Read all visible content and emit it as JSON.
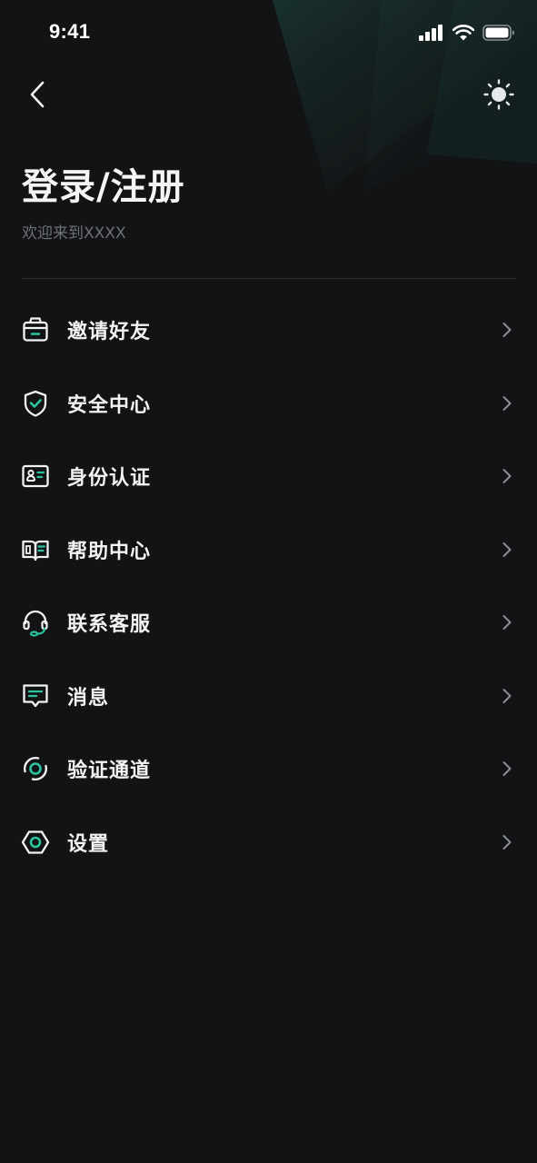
{
  "status_bar": {
    "time": "9:41"
  },
  "header": {
    "title": "登录/注册",
    "subtitle": "欢迎来到XXXX"
  },
  "menu": {
    "items": [
      {
        "key": "invite",
        "label": "邀请好友",
        "icon": "gift-box-icon"
      },
      {
        "key": "security",
        "label": "安全中心",
        "icon": "shield-check-icon"
      },
      {
        "key": "identity",
        "label": "身份认证",
        "icon": "id-card-icon"
      },
      {
        "key": "help",
        "label": "帮助中心",
        "icon": "open-book-icon"
      },
      {
        "key": "support",
        "label": "联系客服",
        "icon": "headset-icon"
      },
      {
        "key": "messages",
        "label": "消息",
        "icon": "message-icon"
      },
      {
        "key": "channel",
        "label": "验证通道",
        "icon": "route-ring-icon"
      },
      {
        "key": "settings",
        "label": "设置",
        "icon": "hexagon-settings-icon"
      }
    ]
  },
  "colors": {
    "background": "#121315",
    "accent": "#2bc4a0",
    "text_primary": "#f2f3f5",
    "text_secondary": "#6d7076",
    "divider": "#2a2c30"
  }
}
